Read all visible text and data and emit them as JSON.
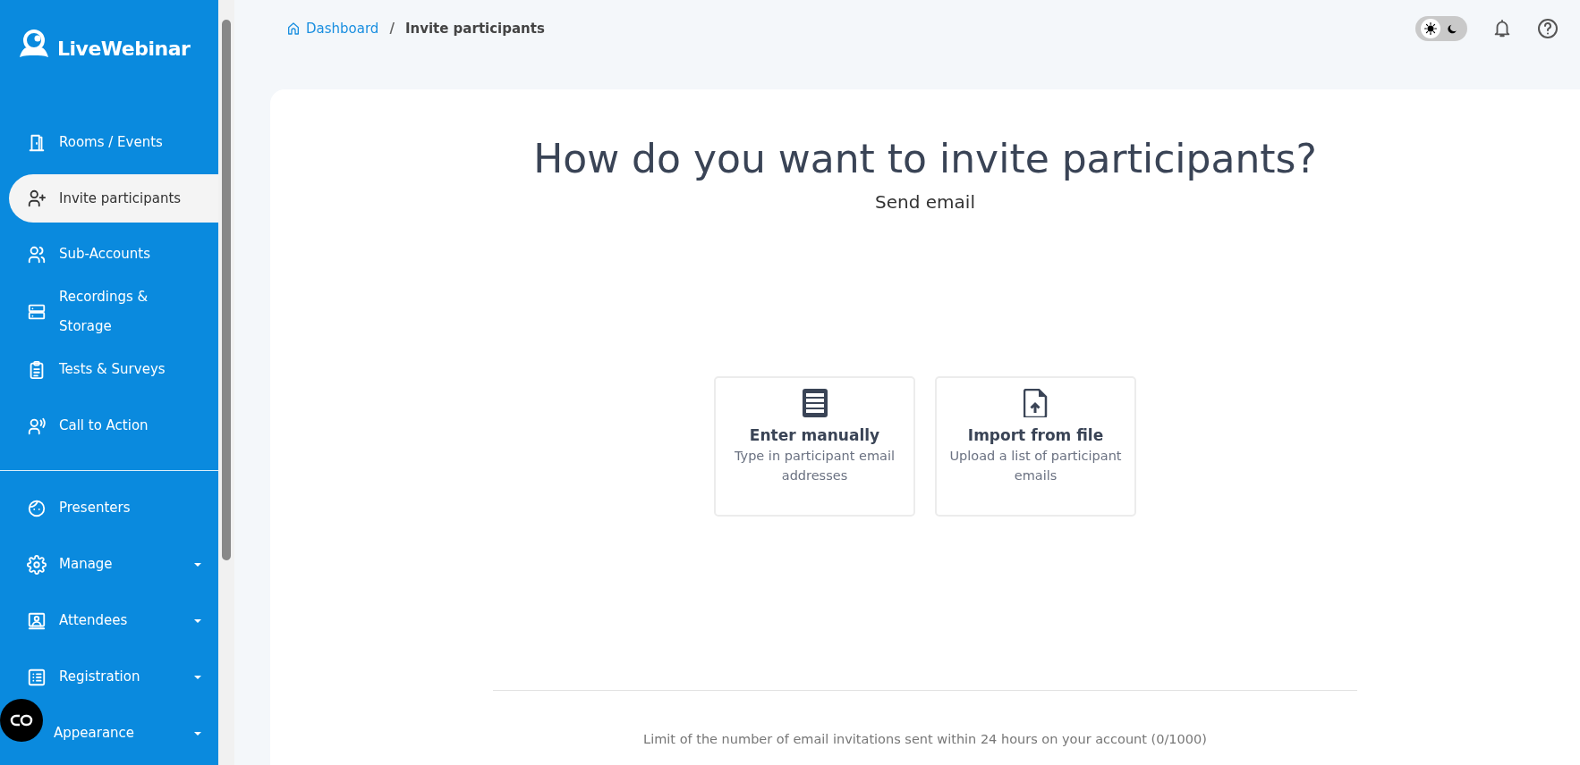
{
  "sidebar": {
    "logo": "LiveWebinar",
    "items": [
      {
        "label": "Rooms / Events",
        "selected": false,
        "has_submenu": false
      },
      {
        "label": "Invite participants",
        "selected": true,
        "has_submenu": false
      },
      {
        "label": "Sub-Accounts",
        "selected": false,
        "has_submenu": false
      },
      {
        "label": "Recordings & Storage",
        "selected": false,
        "has_submenu": false
      },
      {
        "label": "Tests & Surveys",
        "selected": false,
        "has_submenu": false
      },
      {
        "label": "Call to Action",
        "selected": false,
        "has_submenu": false
      },
      {
        "kind": "divider"
      },
      {
        "label": "Presenters",
        "selected": false,
        "has_submenu": false
      },
      {
        "label": "Manage",
        "selected": false,
        "has_submenu": true
      },
      {
        "label": "Attendees",
        "selected": false,
        "has_submenu": true
      },
      {
        "label": "Registration",
        "selected": false,
        "has_submenu": true
      },
      {
        "label": "Appearance",
        "selected": false,
        "has_submenu": true
      }
    ]
  },
  "breadcrumb": [
    {
      "label": "Dashboard"
    },
    {
      "label": "Invite participants"
    }
  ],
  "breadcrumb_separator": "/",
  "header": {
    "dark_mode": false
  },
  "main": {
    "title": "How do you want to invite participants?",
    "subtitle": "Send email",
    "options": [
      {
        "title": "Enter manually",
        "description": "Type in participant email addresses"
      },
      {
        "title": "Import from file",
        "description": "Upload a list of participant emails"
      }
    ],
    "limit_note": "Limit of the number of email invitations sent within 24 hours on your account (0/1000)"
  }
}
